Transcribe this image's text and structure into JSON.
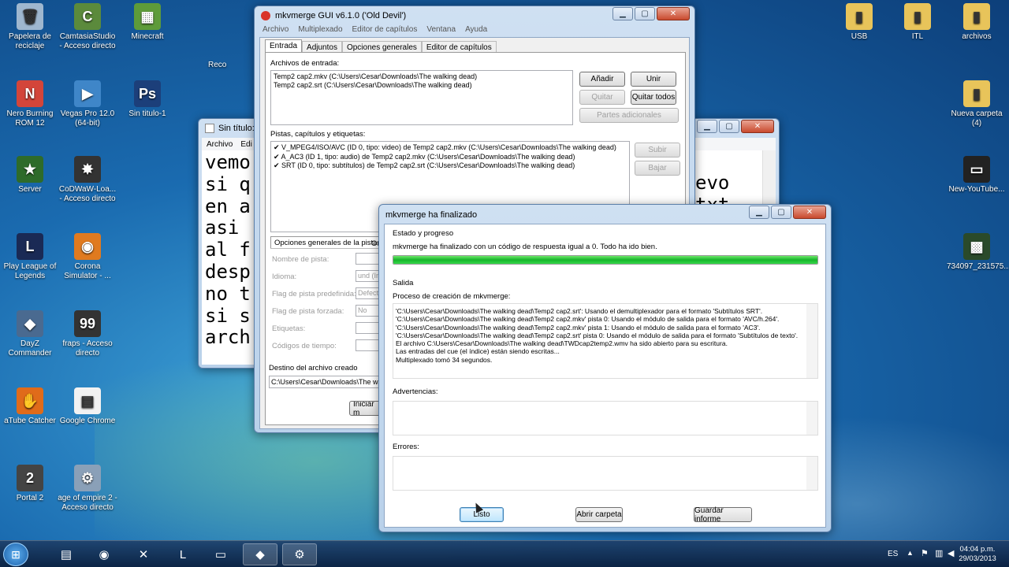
{
  "desktop_icons": [
    {
      "label": "Papelera de reciclaje",
      "glyph": "🗑",
      "color": "#9fb7cf"
    },
    {
      "label": "CamtasiaStudio - Acceso directo",
      "glyph": "C",
      "color": "#5b8a3c"
    },
    {
      "label": "Minecraft",
      "glyph": "▦",
      "color": "#5e9b3a"
    },
    {
      "label": "Reco",
      "glyph": "",
      "color": "transparent"
    },
    {
      "label": "Nero Burning ROM 12",
      "glyph": "N",
      "color": "#d3453a"
    },
    {
      "label": "Vegas Pro 12.0 (64-bit)",
      "glyph": "▶",
      "color": "#3f86c8"
    },
    {
      "label": "Sin titulo-1",
      "glyph": "Ps",
      "color": "#1c3f7a"
    },
    {
      "label": "Server",
      "glyph": "★",
      "color": "#2e6b2a"
    },
    {
      "label": "CoDWaW-Loa... - Acceso directo",
      "glyph": "✸",
      "color": "#333"
    },
    {
      "label": "Play League of Legends",
      "glyph": "L",
      "color": "#1a2a55"
    },
    {
      "label": "Corona Simulator - ...",
      "glyph": "◉",
      "color": "#e07a1f"
    },
    {
      "label": "DayZ Commander",
      "glyph": "◆",
      "color": "#4a6a90"
    },
    {
      "label": "fraps - Acceso directo",
      "glyph": "99",
      "color": "#333"
    },
    {
      "label": "aTube Catcher",
      "glyph": "✋",
      "color": "#e06b1a"
    },
    {
      "label": "Google Chrome",
      "glyph": "▤",
      "color": "#f2f2f2"
    },
    {
      "label": "Portal 2",
      "glyph": "2",
      "color": "#444"
    },
    {
      "label": "age of empire 2 - Acceso directo",
      "glyph": "⚙",
      "color": "#8aa0b8"
    },
    {
      "label": "USB",
      "glyph": "▮",
      "color": "#e8c45a"
    },
    {
      "label": "ITL",
      "glyph": "▮",
      "color": "#e8c45a"
    },
    {
      "label": "archivos",
      "glyph": "▮",
      "color": "#e8c45a"
    },
    {
      "label": "Nueva carpeta (4)",
      "glyph": "▮",
      "color": "#e8c45a"
    },
    {
      "label": "New-YouTube...",
      "glyph": "▭",
      "color": "#222"
    },
    {
      "label": "734097_231575...",
      "glyph": "▩",
      "color": "#2a4a2a"
    }
  ],
  "mkv_main": {
    "title": "mkvmerge GUI v6.1.0 ('Old Devil')",
    "menu": [
      "Archivo",
      "Multiplexado",
      "Editor de capítulos",
      "Ventana",
      "Ayuda"
    ],
    "tabs": [
      "Entrada",
      "Adjuntos",
      "Opciones generales",
      "Editor de capítulos"
    ],
    "input_files_label": "Archivos de entrada:",
    "input_files": [
      "Temp2 cap2.mkv (C:\\Users\\Cesar\\Downloads\\The walking dead)",
      "Temp2 cap2.srt (C:\\Users\\Cesar\\Downloads\\The walking dead)"
    ],
    "buttons": {
      "add": "Añadir",
      "append": "Unir",
      "remove": "Quitar",
      "remove_all": "Quitar todos",
      "additional_parts": "Partes adicionales",
      "up": "Subir",
      "down": "Bajar",
      "start": "Iniciar m"
    },
    "tracks_label": "Pistas, capítulos y etiquetas:",
    "tracks": [
      "V_MPEG4/ISO/AVC (ID 0, tipo: video) de Temp2 cap2.mkv (C:\\Users\\Cesar\\Downloads\\The walking dead)",
      "A_AC3 (ID 1, tipo: audio) de Temp2 cap2.mkv (C:\\Users\\Cesar\\Downloads\\The walking dead)",
      "SRT (ID 0, tipo: subtítulos) de Temp2 cap2.srt (C:\\Users\\Cesar\\Downloads\\The walking dead)"
    ],
    "subtab": "Opciones generales de la pista",
    "subtab2": "Ot",
    "track_fields": [
      "Nombre de pista:",
      "Idioma:",
      "Flag de pista predefinida:",
      "Flag de pista forzada:",
      "Etiquetas:",
      "Códigos de tiempo:"
    ],
    "track_values": [
      "",
      "und (Ind",
      "Defect",
      "No",
      "",
      ""
    ],
    "dest_label": "Destino del archivo creado",
    "dest_value": "C:\\Users\\Cesar\\Downloads\\The walki"
  },
  "notepad": {
    "title": "Sin título: B",
    "menu": [
      "Archivo",
      "Edi"
    ],
    "lines": [
      "vemo",
      "si q",
      "en a",
      "asi",
      "al f",
      "desp",
      "no t",
      "si s",
      "arch"
    ],
    "right_lines": [
      "evo",
      "txt"
    ]
  },
  "dialog": {
    "title": "mkvmerge ha finalizado",
    "status_label": "Estado y progreso",
    "status_text": "mkvmerge ha finalizado con un código de respuesta igual a 0. Todo ha ido bien.",
    "progress": 1.0,
    "output_label": "Salida",
    "process_label": "Proceso de creación de mkvmerge:",
    "log": [
      "'C:\\Users\\Cesar\\Downloads\\The walking dead\\Temp2 cap2.srt': Usando el demultiplexador para el formato 'Subtítulos SRT'.",
      "'C:\\Users\\Cesar\\Downloads\\The walking dead\\Temp2 cap2.mkv' pista 0: Usando el módulo de salida para el formato 'AVC/h.264'.",
      "'C:\\Users\\Cesar\\Downloads\\The walking dead\\Temp2 cap2.mkv' pista 1: Usando el módulo de salida para el formato 'AC3'.",
      "'C:\\Users\\Cesar\\Downloads\\The walking dead\\Temp2 cap2.srt' pista 0: Usando el módulo de salida para el formato 'Subtítulos de texto'.",
      "El archivo C:\\Users\\Cesar\\Downloads\\The walking dead\\TWDcap2temp2.wmv ha sido abierto para su escritura.",
      "Las entradas del cue (el índice) están siendo escritas...",
      "Multiplexado tomó 34 segundos."
    ],
    "warnings_label": "Advertencias:",
    "errors_label": "Errores:",
    "ok": "Listo",
    "open_folder": "Abrir carpeta",
    "save_report": "Guardar informe"
  },
  "taskbar": {
    "apps": [
      "⊞",
      "▤",
      "◉",
      "✕",
      "L",
      "▭",
      "◆",
      "⚙"
    ],
    "lang": "ES",
    "time": "04:04 p.m.",
    "date": "29/03/2013"
  },
  "colors": {
    "progress": "#22c83a",
    "accent": "#3399ff"
  }
}
